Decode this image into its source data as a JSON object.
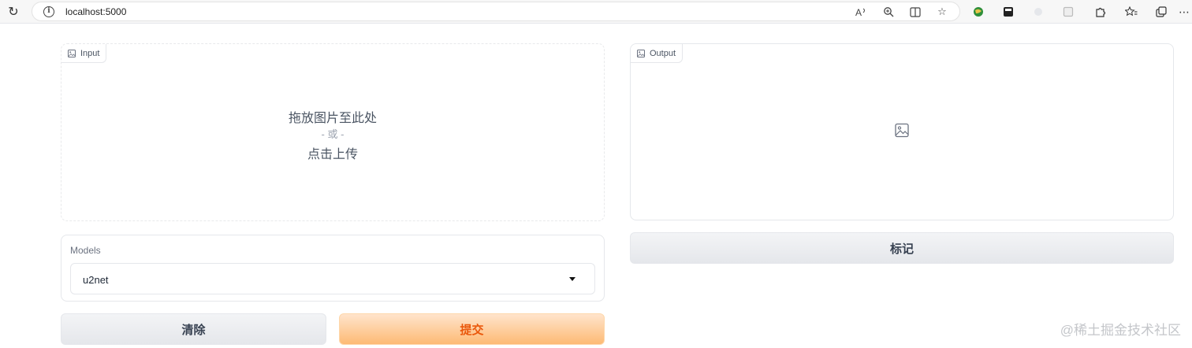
{
  "browser": {
    "url": "localhost:5000"
  },
  "input_panel": {
    "label": "Input",
    "drop_main": "拖放图片至此处",
    "drop_or": "- 或 -",
    "drop_sub": "点击上传"
  },
  "output_panel": {
    "label": "Output"
  },
  "models": {
    "label": "Models",
    "selected": "u2net"
  },
  "buttons": {
    "clear": "清除",
    "submit": "提交",
    "flag": "标记"
  },
  "watermark": "@稀土掘金技术社区",
  "colors": {
    "primary_text": "#ea580c",
    "primary_bg": "#fdba74",
    "secondary_bg": "#e5e7eb"
  }
}
